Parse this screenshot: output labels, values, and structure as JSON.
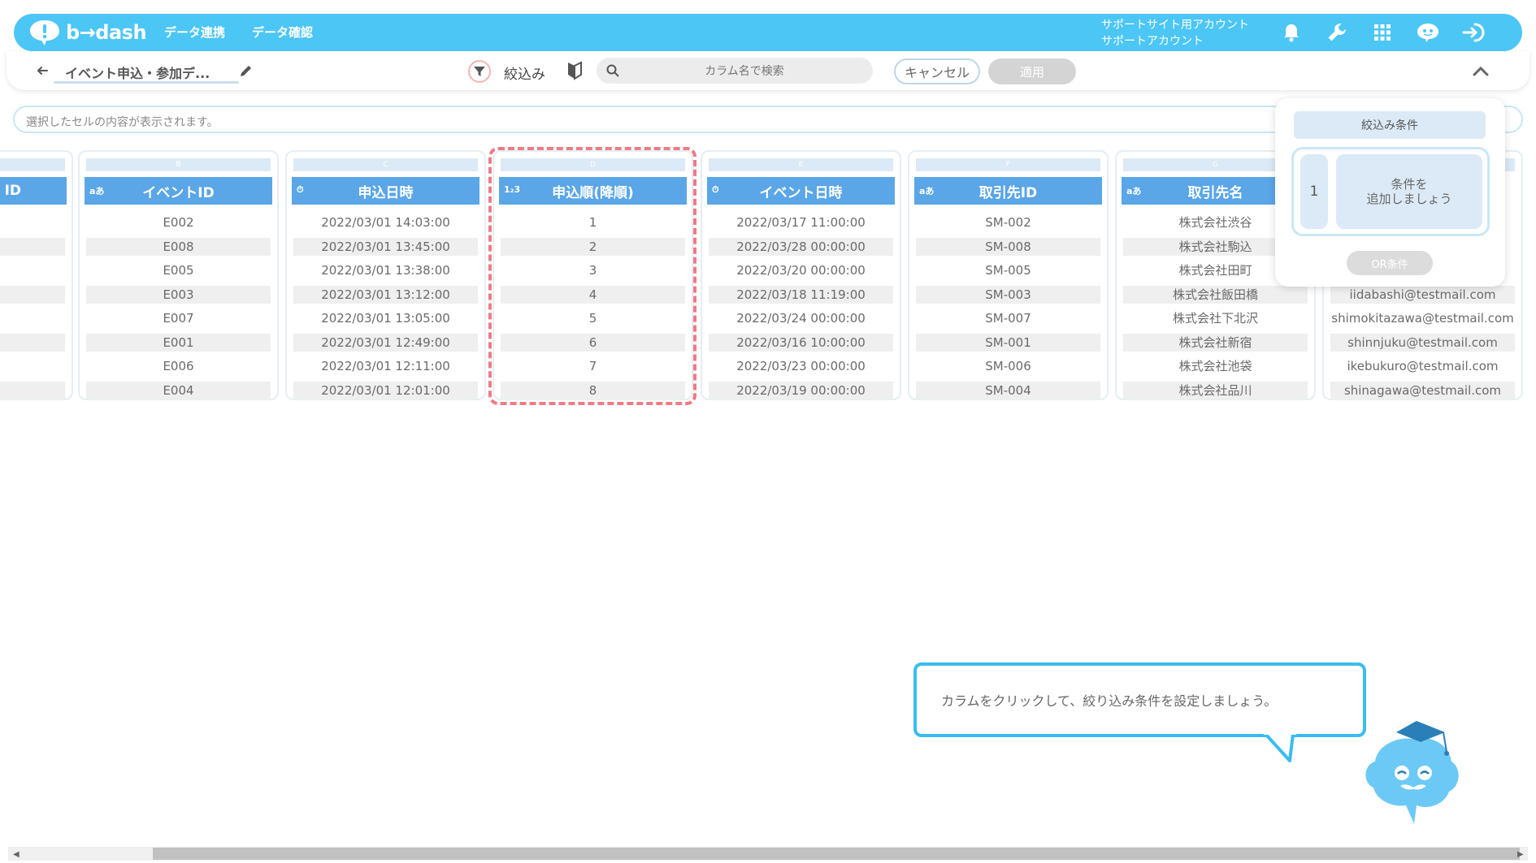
{
  "app": {
    "logo_text": "b→dash"
  },
  "nav": {
    "items": [
      "データ連携",
      "データ確認"
    ]
  },
  "account": {
    "line1": "サポートサイト用アカウント",
    "line2": "サポートアカウント"
  },
  "top_icons": [
    "bell-icon",
    "wrench-icon",
    "grid-icon",
    "chatbot-icon",
    "logout-icon"
  ],
  "toolbar": {
    "title": "イベント申込・参加デ...",
    "filter_label": "絞込み",
    "search_placeholder": "カラム名で検索",
    "cancel_label": "キャンセル",
    "apply_label": "適用"
  },
  "cellbar": {
    "text": "選択したセルの内容が表示されます。"
  },
  "columns": [
    {
      "letter": "",
      "type": "",
      "name": "ID",
      "values": [
        "",
        "",
        "",
        "",
        "",
        "",
        "",
        ""
      ]
    },
    {
      "letter": "B",
      "type": "aあ",
      "name": "イベントID",
      "values": [
        "E002",
        "E008",
        "E005",
        "E003",
        "E007",
        "E001",
        "E006",
        "E004"
      ]
    },
    {
      "letter": "C",
      "type": "⏱",
      "name": "申込日時",
      "values": [
        "2022/03/01 14:03:00",
        "2022/03/01 13:45:00",
        "2022/03/01 13:38:00",
        "2022/03/01 13:12:00",
        "2022/03/01 13:05:00",
        "2022/03/01 12:49:00",
        "2022/03/01 12:11:00",
        "2022/03/01 12:01:00"
      ]
    },
    {
      "letter": "D",
      "type": "1₂3",
      "name": "申込順(降順)",
      "values": [
        "1",
        "2",
        "3",
        "4",
        "5",
        "6",
        "7",
        "8"
      ]
    },
    {
      "letter": "E",
      "type": "⏱",
      "name": "イベント日時",
      "values": [
        "2022/03/17 11:00:00",
        "2022/03/28 00:00:00",
        "2022/03/20 00:00:00",
        "2022/03/18 11:19:00",
        "2022/03/24 00:00:00",
        "2022/03/16 10:00:00",
        "2022/03/23 00:00:00",
        "2022/03/19 00:00:00"
      ]
    },
    {
      "letter": "F",
      "type": "aあ",
      "name": "取引先ID",
      "values": [
        "SM-002",
        "SM-008",
        "SM-005",
        "SM-003",
        "SM-007",
        "SM-001",
        "SM-006",
        "SM-004"
      ]
    },
    {
      "letter": "G",
      "type": "aあ",
      "name": "取引先名",
      "values": [
        "株式会社渋谷",
        "株式会社駒込",
        "株式会社田町",
        "株式会社飯田橋",
        "株式会社下北沢",
        "株式会社新宿",
        "株式会社池袋",
        "株式会社品川"
      ]
    },
    {
      "letter": "",
      "type": "",
      "name": "",
      "values": [
        "",
        "",
        "",
        "iidabashi@testmail.com",
        "shimokitazawa@testmail.com",
        "shinnjuku@testmail.com",
        "ikebukuro@testmail.com",
        "shinagawa@testmail.com"
      ]
    }
  ],
  "panel": {
    "title": "絞込み条件",
    "cond_number": "1",
    "add_condition": "条件を\n追加しましょう",
    "or_label": "OR条件"
  },
  "tooltip": {
    "text": "カラムをクリックして、絞り込み条件を設定しましょう。"
  },
  "colors": {
    "primary": "#4cc6f5",
    "column_header": "#5aa6e6",
    "highlight_dash": "#f07a84"
  }
}
